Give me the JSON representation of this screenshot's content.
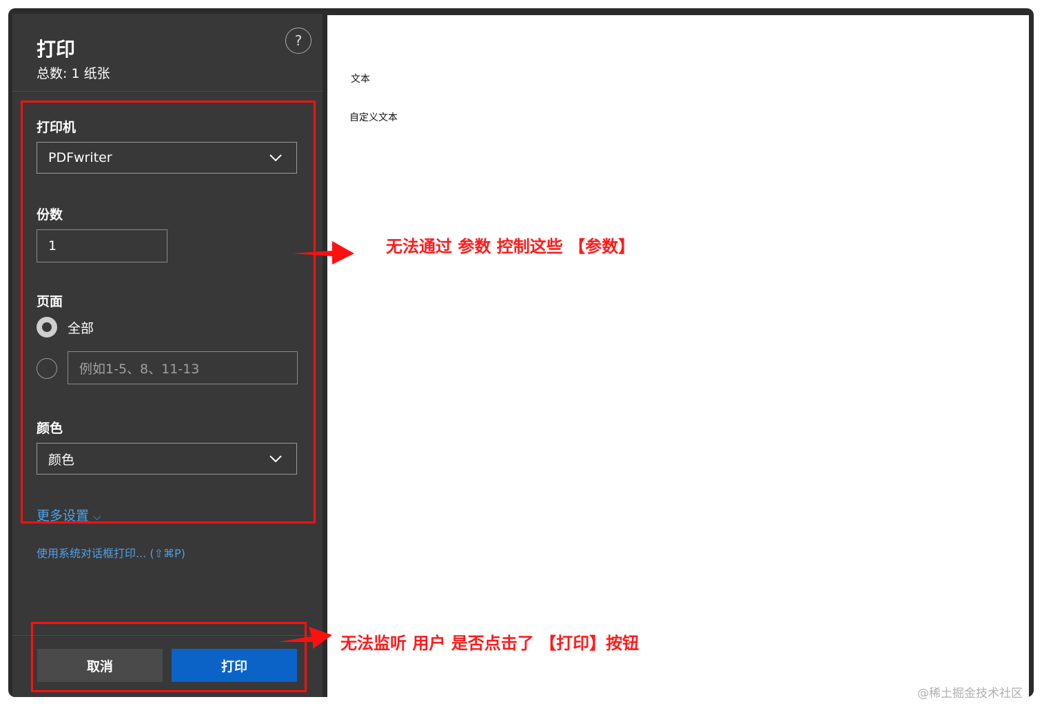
{
  "dialog": {
    "title": "打印",
    "subtitle": "总数: 1 纸张",
    "help_icon": "?",
    "printer_label": "打印机",
    "printer_value": "PDFwriter",
    "copies_label": "份数",
    "copies_value": "1",
    "pages_label": "页面",
    "pages_all_label": "全部",
    "pages_range_placeholder": "例如1-5、8、11-13",
    "color_label": "颜色",
    "color_value": "颜色",
    "more_settings": "更多设置",
    "more_settings_chevron": "⌵",
    "system_dialog_link": "使用系统对话框打印... (⇧⌘P)",
    "cancel_button": "取消",
    "print_button": "打印"
  },
  "preview": {
    "line1": "文本",
    "line2": "自定义文本"
  },
  "annotations": {
    "note1": "无法通过 参数 控制这些 【参数】",
    "note2": "无法监听 用户 是否点击了 【打印】按钮",
    "color": "#ff1010"
  },
  "watermark": "@稀土掘金技术社区"
}
